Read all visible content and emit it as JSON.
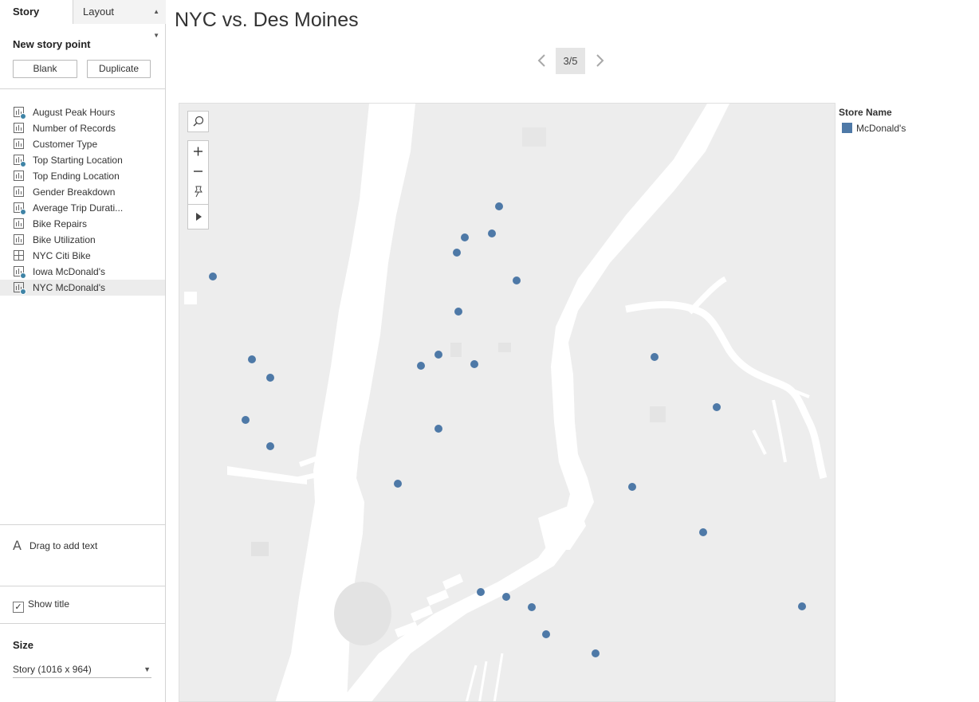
{
  "pane": {
    "tab_story": "Story",
    "tab_layout": "Layout",
    "new_story_point": "New story point",
    "blank": "Blank",
    "duplicate": "Duplicate",
    "drag_to_add_text": "Drag to add text",
    "drag_icon_glyph": "A",
    "show_title": "Show title",
    "show_title_checked": true,
    "size_label": "Size",
    "size_value": "Story (1016 x 964)"
  },
  "sheets": [
    {
      "label": "August Peak Hours",
      "icon": "bar-chart-icon",
      "used": true
    },
    {
      "label": "Number of Records",
      "icon": "bar-chart-icon",
      "used": false
    },
    {
      "label": "Customer Type",
      "icon": "bar-chart-icon",
      "used": false
    },
    {
      "label": "Top Starting Location",
      "icon": "bar-chart-icon",
      "used": true
    },
    {
      "label": "Top Ending Location",
      "icon": "bar-chart-icon",
      "used": false
    },
    {
      "label": "Gender Breakdown",
      "icon": "bar-chart-icon",
      "used": false
    },
    {
      "label": "Average Trip Durati...",
      "icon": "bar-chart-icon",
      "used": true
    },
    {
      "label": "Bike Repairs",
      "icon": "bar-chart-icon",
      "used": false
    },
    {
      "label": "Bike Utilization",
      "icon": "bar-chart-icon",
      "used": false
    },
    {
      "label": "NYC Citi Bike",
      "icon": "dashboard-icon",
      "used": false
    },
    {
      "label": "Iowa McDonald's",
      "icon": "bar-chart-icon",
      "used": true
    },
    {
      "label": "NYC McDonald's",
      "icon": "bar-chart-icon",
      "used": true,
      "selected": true
    }
  ],
  "story": {
    "title": "NYC vs. Des Moines",
    "point_indicator": "3/5",
    "current_point": 3,
    "total_points": 5
  },
  "legend": {
    "title": "Store Name",
    "item": "McDonald's",
    "color": "#4e79a7"
  },
  "map_tools": [
    "search-icon",
    "zoom-in-icon",
    "zoom-out-icon",
    "pin-icon",
    "expand-arrow-icon"
  ],
  "colors": {
    "marker": "#4e79a7",
    "land": "#ededed",
    "water": "#ffffff",
    "check": "#3f84a6"
  }
}
